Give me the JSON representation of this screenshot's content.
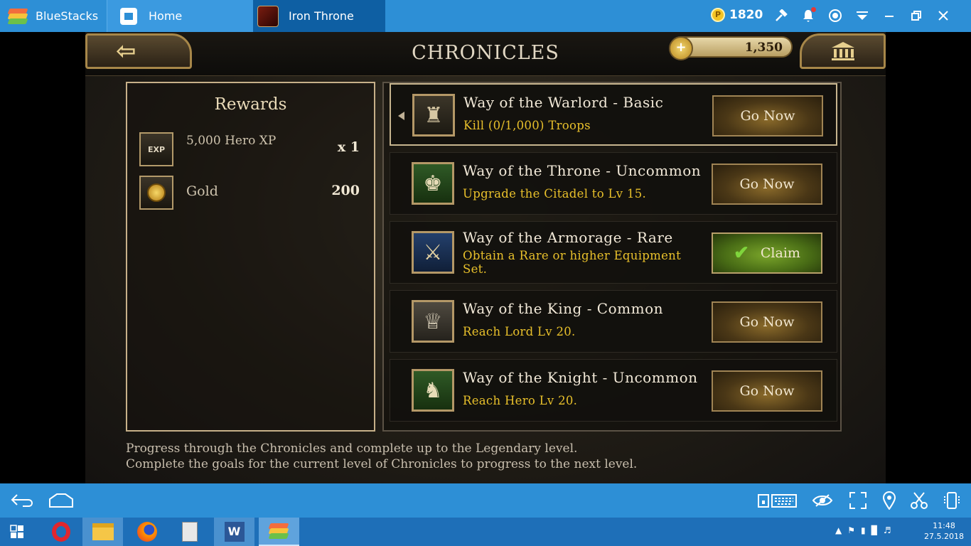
{
  "titlebar": {
    "app_name": "BlueStacks",
    "home_tab": "Home",
    "game_tab": "Iron Throne",
    "coin_symbol": "P",
    "coins": "1820"
  },
  "game": {
    "title": "CHRONICLES",
    "gold": "1,350",
    "rewards": {
      "title": "Rewards",
      "items": [
        {
          "icon": "exp-helmet-icon",
          "icon_text": "EXP",
          "name": "5,000 Hero XP",
          "qty": "x 1"
        },
        {
          "icon": "gold-coin-icon",
          "name": "Gold",
          "qty": "200"
        }
      ]
    },
    "quests": [
      {
        "title": "Way of the Warlord - Basic",
        "desc": "Kill (0/1,000) Troops",
        "button": "Go Now",
        "icon": "knight-helmet-icon",
        "selected": true
      },
      {
        "title": "Way of the Throne - Uncommon",
        "desc": "Upgrade the Citadel to Lv 15.",
        "button": "Go Now",
        "icon": "throne-icon"
      },
      {
        "title": "Way of the Armorage - Rare",
        "desc": "Obtain a Rare or higher Equipment Set.",
        "button": "Claim",
        "icon": "sword-shield-icon"
      },
      {
        "title": "Way of the King - Common",
        "desc": "Reach Lord Lv 20.",
        "button": "Go Now",
        "icon": "crown-icon"
      },
      {
        "title": "Way of the Knight - Uncommon",
        "desc": "Reach Hero Lv 20.",
        "button": "Go Now",
        "icon": "knight-head-icon"
      }
    ],
    "footer": [
      "Progress through the Chronicles and complete up to the Legendary level.",
      "Complete the goals for the current level of Chronicles to progress to the next level."
    ]
  },
  "taskbar": {
    "time": "11:48",
    "date": "27.5.2018"
  },
  "colors": {
    "bluestacks_bar": "#2d8fd6",
    "taskbar": "#1e6fb8",
    "quest_desc": "#e8c02b",
    "claim_green": "#4a6e16"
  }
}
